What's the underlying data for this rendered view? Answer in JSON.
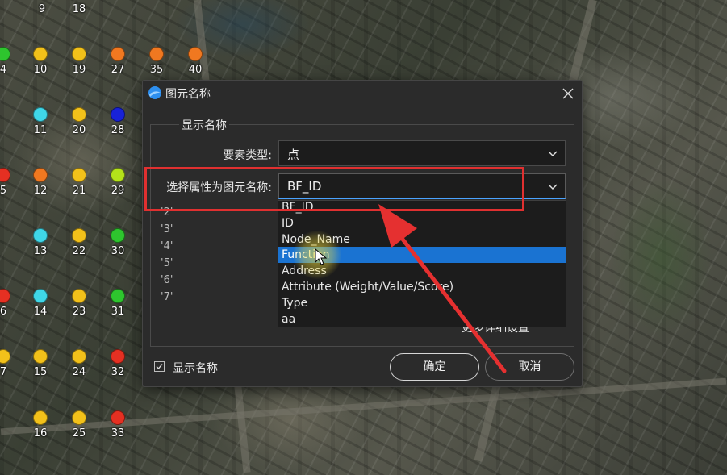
{
  "colors": {
    "red": "#e53022",
    "orange": "#f07820",
    "yellow": "#f2c11a",
    "lime": "#b4e21a",
    "green": "#2ec52e",
    "cyan": "#3fd7e8",
    "blue": "#1822d8",
    "annotation_red": "#e03030",
    "selection_blue": "#1a73d2"
  },
  "map_points": [
    {
      "label": "9",
      "color": "yellow"
    },
    {
      "label": "18",
      "color": "yellow"
    },
    {
      "label": "4",
      "color": "green"
    },
    {
      "label": "10",
      "color": "yellow"
    },
    {
      "label": "19",
      "color": "yellow"
    },
    {
      "label": "27",
      "color": "orange"
    },
    {
      "label": "35",
      "color": "orange"
    },
    {
      "label": "40",
      "color": "orange"
    },
    {
      "label": "11",
      "color": "cyan"
    },
    {
      "label": "20",
      "color": "yellow"
    },
    {
      "label": "28",
      "color": "blue"
    },
    {
      "label": "5",
      "color": "red"
    },
    {
      "label": "12",
      "color": "orange"
    },
    {
      "label": "21",
      "color": "yellow"
    },
    {
      "label": "29",
      "color": "lime"
    },
    {
      "label": "13",
      "color": "cyan"
    },
    {
      "label": "22",
      "color": "yellow"
    },
    {
      "label": "30",
      "color": "green"
    },
    {
      "label": "6",
      "color": "red"
    },
    {
      "label": "14",
      "color": "cyan"
    },
    {
      "label": "23",
      "color": "yellow"
    },
    {
      "label": "31",
      "color": "green"
    },
    {
      "label": "7",
      "color": "yellow"
    },
    {
      "label": "15",
      "color": "yellow"
    },
    {
      "label": "24",
      "color": "yellow"
    },
    {
      "label": "32",
      "color": "red"
    },
    {
      "label": "16",
      "color": "yellow"
    },
    {
      "label": "25",
      "color": "yellow"
    },
    {
      "label": "33",
      "color": "red"
    }
  ],
  "dialog": {
    "title": "图元名称",
    "app_icon": "app-logo-icon",
    "close_icon": "close-icon",
    "group_title": "显示名称",
    "feature_type_label": "要素类型:",
    "feature_type_value": "点",
    "attribute_label": "选择属性为图元名称:",
    "attribute_value": "BF_ID",
    "dropdown_icon": "chevron-down-icon",
    "preview_values": [
      "'2'",
      "'3'",
      "'4'",
      "'5'",
      "'6'",
      "'7'"
    ],
    "more_settings": "更多详细设置",
    "show_name_checkbox": {
      "label": "显示名称",
      "checked": true
    },
    "ok": "确定",
    "cancel": "取消"
  },
  "dropdown": {
    "items": [
      "BF_ID",
      "ID",
      "Node_Name",
      "Function",
      "Address",
      "Attribute (Weight/Value/Score)",
      "Type",
      "aa"
    ],
    "highlighted": "Function"
  },
  "annotation": {
    "arrow_icon": "red-arrow-icon",
    "cursor_icon": "mouse-pointer-icon"
  }
}
